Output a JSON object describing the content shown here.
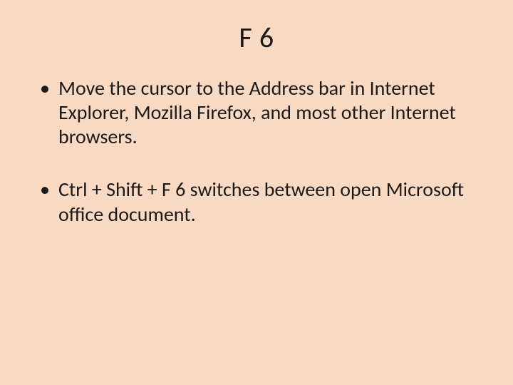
{
  "slide": {
    "title": "F 6",
    "bullets": [
      "Move the cursor to the Address bar in Internet Explorer, Mozilla Firefox, and most other Internet browsers.",
      "Ctrl + Shift + F 6 switches between open Microsoft office document."
    ]
  }
}
